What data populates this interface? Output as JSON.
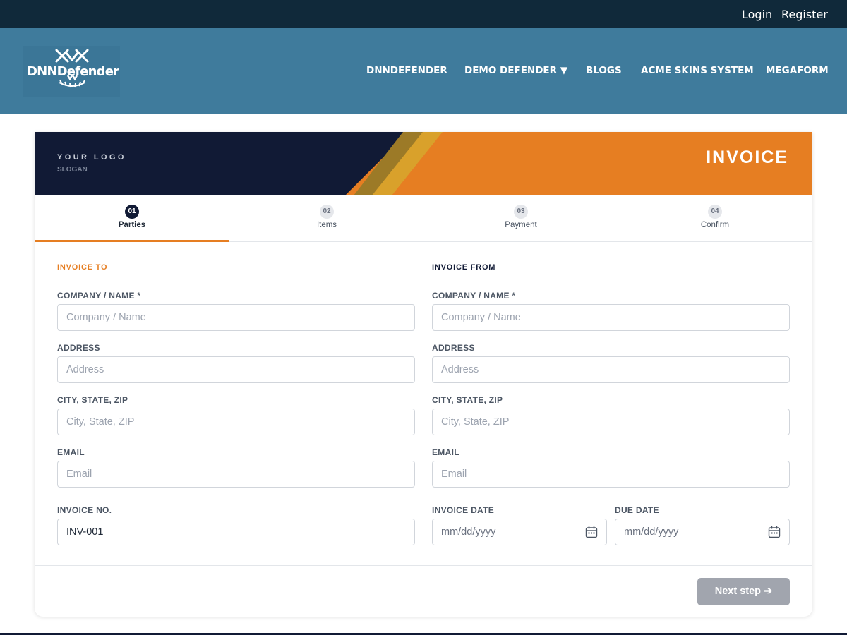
{
  "topbar": {
    "login": "Login",
    "register": "Register"
  },
  "navbar": {
    "logo_text": "DNNDefender",
    "items": [
      "DNNDEFENDER",
      "DEMO DEFENDER ▼",
      "BLOGS",
      "ACME SKINS SYSTEM",
      "MEGAFORM"
    ]
  },
  "banner": {
    "logo": "YOUR LOGO",
    "slogan": "SLOGAN",
    "title": "INVOICE"
  },
  "steps": [
    {
      "num": "01",
      "label": "Parties",
      "active": true
    },
    {
      "num": "02",
      "label": "Items",
      "active": false
    },
    {
      "num": "03",
      "label": "Payment",
      "active": false
    },
    {
      "num": "04",
      "label": "Confirm",
      "active": false
    }
  ],
  "invoice_to": {
    "heading": "INVOICE TO",
    "company_label": "COMPANY / NAME *",
    "company_placeholder": "Company / Name",
    "address_label": "ADDRESS",
    "address_placeholder": "Address",
    "city_label": "CITY, STATE, ZIP",
    "city_placeholder": "City, State, ZIP",
    "email_label": "EMAIL",
    "email_placeholder": "Email"
  },
  "invoice_from": {
    "heading": "INVOICE FROM",
    "company_label": "COMPANY / NAME *",
    "company_placeholder": "Company / Name",
    "address_label": "ADDRESS",
    "address_placeholder": "Address",
    "city_label": "CITY, STATE, ZIP",
    "city_placeholder": "City, State, ZIP",
    "email_label": "EMAIL",
    "email_placeholder": "Email"
  },
  "meta": {
    "invoice_no_label": "INVOICE NO.",
    "invoice_no_value": "INV-001",
    "invoice_date_label": "INVOICE DATE",
    "invoice_date_value": "mm/dd/yyyy",
    "due_date_label": "DUE DATE",
    "due_date_value": "mm/dd/yyyy"
  },
  "footer": {
    "next_label": "Next step ➔"
  },
  "colors": {
    "accent": "#e67e22",
    "navy": "#111a35",
    "nav_bg": "#3f7b9c",
    "topbar_bg": "#10293a"
  }
}
